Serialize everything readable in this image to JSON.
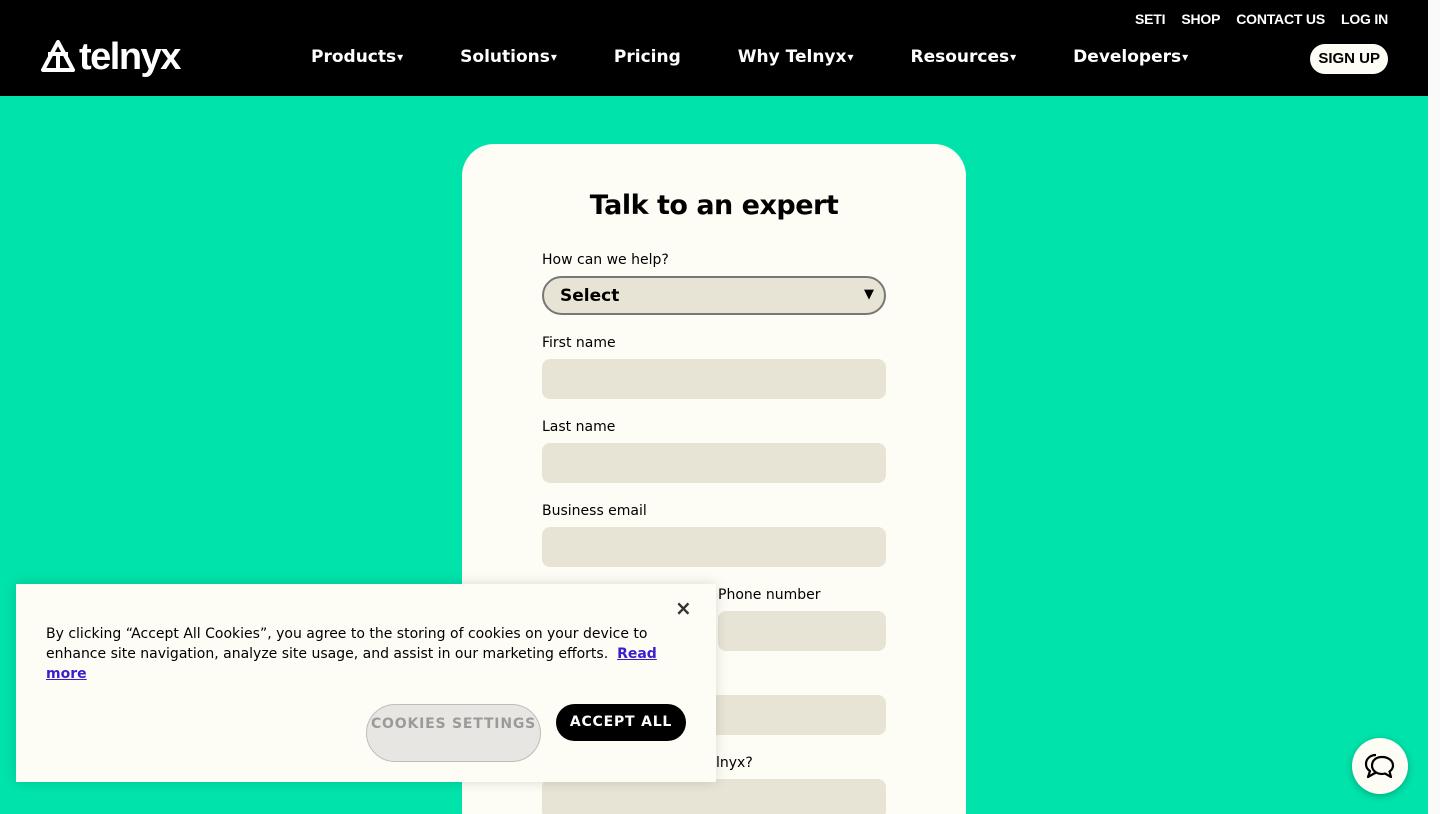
{
  "header": {
    "logo": "telnyx",
    "util_links": [
      "SETI",
      "SHOP",
      "CONTACT US",
      "LOG IN"
    ],
    "nav": [
      {
        "label": "Products",
        "caret": "▾"
      },
      {
        "label": "Solutions",
        "caret": "▾"
      },
      {
        "label": "Pricing",
        "caret": ""
      },
      {
        "label": "Why Telnyx",
        "caret": "▾"
      },
      {
        "label": "Resources",
        "caret": "▾"
      },
      {
        "label": "Developers",
        "caret": "▾"
      }
    ],
    "signup": "SIGN UP"
  },
  "form": {
    "title": "Talk to an expert",
    "help_label": "How can we help?",
    "help_value": "Select",
    "first_name_label": "First name",
    "last_name_label": "Last name",
    "email_label": "Business email",
    "phone_label": "Phone number",
    "partial_label": "lnyx?"
  },
  "cookie": {
    "close": "×",
    "text": "By clicking “Accept All Cookies”, you agree to the storing of cookies on your device to enhance site navigation, analyze site usage, and assist in our marketing efforts.",
    "read_more": "Read more",
    "settings_button": "COOKIES SETTINGS",
    "accept_button": "ACCEPT ALL"
  },
  "colors": {
    "background": "#00e3aa",
    "header": "#000000",
    "card": "#fefdf5",
    "input": "#e8e4d5",
    "link": "#3b1fcf"
  }
}
